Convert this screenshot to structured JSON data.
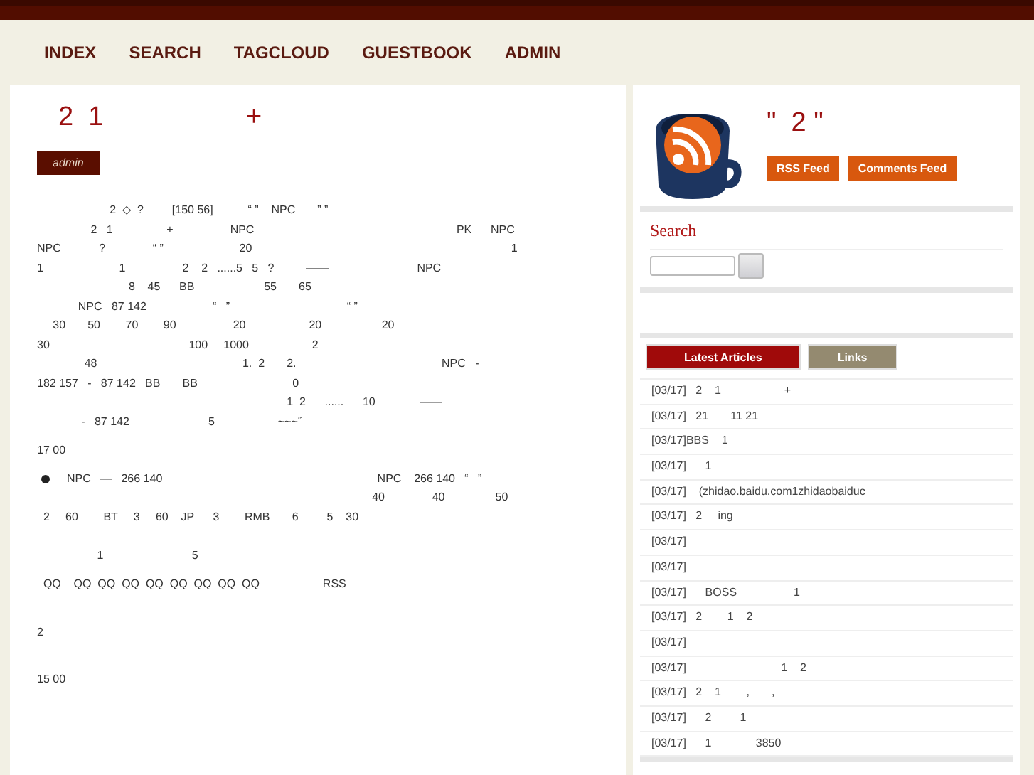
{
  "nav": [
    "INDEX",
    "SEARCH",
    "TAGCLOUD",
    "GUESTBOOK",
    "ADMIN"
  ],
  "post": {
    "title": "2  1                   +",
    "author": "admin",
    "lines": [
      {
        "kind": "text",
        "text": "                       2  ◇  ?         [150 56]           “ ”    NPC       ” ”"
      },
      {
        "kind": "text",
        "text": "                 2   1                 +                  NPC                                                                PK      NPC"
      },
      {
        "kind": "text",
        "text": "NPC            ?               “ ”                        20                                                                                  1"
      },
      {
        "kind": "text",
        "text": "1                        1                  2    2   ......5   5   ?          ——                            NPC"
      },
      {
        "kind": "text",
        "text": "                             8    45      BB                      55       65"
      },
      {
        "kind": "text",
        "text": "             NPC   87 142                     “   ”                                     “ ”"
      },
      {
        "kind": "text",
        "text": "     30       50        70        90                  20                    20                   20"
      },
      {
        "kind": "text",
        "text": "30                                            100     1000                    2"
      },
      {
        "kind": "text",
        "text": "               48                                              1.  2       2.                                              NPC   -"
      },
      {
        "kind": "text",
        "text": "182 157   -   87 142   BB       BB                              0"
      },
      {
        "kind": "text",
        "text": "                                                                               1  2      ......      10              ——"
      },
      {
        "kind": "text",
        "text": "              -   87 142                         5                    ~~~˝"
      },
      {
        "kind": "gap"
      },
      {
        "kind": "text",
        "text": "17 00"
      },
      {
        "kind": "gap"
      },
      {
        "kind": "bullet",
        "text": "NPC   —   266 140                                                                    NPC    266 140   “   ”"
      },
      {
        "kind": "text",
        "text": "                                                                                                          40               40                50"
      },
      {
        "kind": "text",
        "text": "  2     60        BT     3     60    JP      3        RMB       6         5    30"
      },
      {
        "kind": "gap"
      },
      {
        "kind": "gap"
      },
      {
        "kind": "text",
        "text": "                   1                            5"
      },
      {
        "kind": "gap"
      },
      {
        "kind": "text",
        "text": "  QQ    QQ  QQ  QQ  QQ  QQ  QQ  QQ  QQ                    RSS"
      },
      {
        "kind": "gap"
      },
      {
        "kind": "gap"
      },
      {
        "kind": "gap"
      },
      {
        "kind": "text",
        "text": "2"
      },
      {
        "kind": "gap"
      },
      {
        "kind": "gap"
      },
      {
        "kind": "gap"
      },
      {
        "kind": "text",
        "text": "15 00"
      }
    ]
  },
  "feed": {
    "title": "\"  2 \"",
    "buttons": [
      "RSS Feed",
      "Comments Feed"
    ]
  },
  "search": {
    "title": "Search"
  },
  "tabs": [
    {
      "label": "Latest Articles",
      "selected": true
    },
    {
      "label": "Links",
      "selected": false
    }
  ],
  "articles": [
    "[03/17]   2    1                    +",
    "[03/17]   21       11 21",
    "[03/17]BBS    1",
    "[03/17]      1",
    "[03/17]    (zhidao.baidu.com1zhidaobaiduc",
    "[03/17]   2     ing",
    "[03/17]",
    "[03/17]",
    "[03/17]      BOSS                  1",
    "[03/17]   2        1    2",
    "[03/17]",
    "[03/17]                              1    2",
    "[03/17]   2    1        ,       ,",
    "[03/17]      2         1",
    "[03/17]      1              3850"
  ]
}
